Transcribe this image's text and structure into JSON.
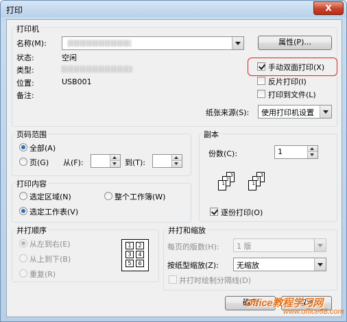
{
  "window": {
    "title": "打印",
    "close_glyph": "X"
  },
  "printer": {
    "group_label": "打印机",
    "name_label": "名称(M):",
    "properties_button": "属性(P)...",
    "status_label": "状态:",
    "status_value": "空闲",
    "type_label": "类型:",
    "location_label": "位置:",
    "location_value": "USB001",
    "comment_label": "备注:",
    "duplex_label": "手动双面打印(X)",
    "reverse_label": "反片打印(I)",
    "print_to_file_label": "打印到文件(L)",
    "paper_source_label": "纸张来源(S):",
    "paper_source_value": "使用打印机设置"
  },
  "page_range": {
    "group_label": "页码范围",
    "all_label": "全部(A)",
    "pages_label": "页(G)",
    "from_label": "从(F):",
    "to_label": "到(T):",
    "from_value": "",
    "to_value": ""
  },
  "copies": {
    "group_label": "副本",
    "count_label": "份数(C):",
    "count_value": "1",
    "collate_label": "逐份打印(O)",
    "collate_icon_labels": [
      "1",
      "2",
      "3"
    ]
  },
  "print_what": {
    "group_label": "打印内容",
    "selection_label": "选定区域(N)",
    "entire_workbook_label": "整个工作簿(W)",
    "active_sheets_label": "选定工作表(V)"
  },
  "order": {
    "group_label": "并打顺序",
    "left_to_right_label": "从左到右(E)",
    "top_to_bottom_label": "从上到下(B)",
    "repeat_label": "重复(R)",
    "preview_cells": [
      "1",
      "2",
      "3",
      "4",
      "5",
      "6"
    ]
  },
  "zoom": {
    "group_label": "并打和缩放",
    "pages_per_sheet_label": "每页的版数(H):",
    "pages_per_sheet_value": "1 版",
    "scale_to_paper_label": "按纸型缩放(Z):",
    "scale_to_paper_value": "无缩放",
    "draw_borders_label": "并打时绘制分隔线(D)"
  },
  "buttons": {
    "ok_label": "确定",
    "cancel_label": "取消"
  },
  "watermark": {
    "line1": "Office教程学习网",
    "line2": "www.office68.com"
  },
  "colors": {
    "highlight_box": "#e0201f",
    "watermark": "#e8731b",
    "radio_selected": "#2b6fb9"
  }
}
